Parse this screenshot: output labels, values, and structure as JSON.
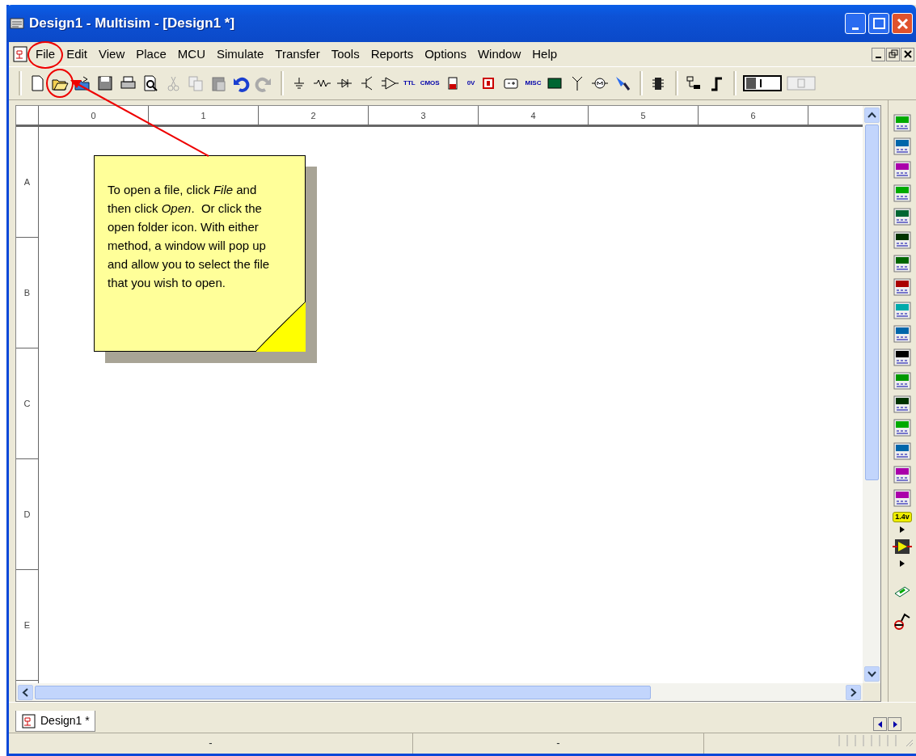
{
  "window": {
    "title": "Design1 - Multisim - [Design1 *]"
  },
  "menu": [
    {
      "label": "File",
      "circled": true
    },
    {
      "label": "Edit",
      "circled": false
    },
    {
      "label": "View",
      "circled": false
    },
    {
      "label": "Place",
      "circled": false
    },
    {
      "label": "MCU",
      "circled": false
    },
    {
      "label": "Simulate",
      "circled": false
    },
    {
      "label": "Transfer",
      "circled": false
    },
    {
      "label": "Tools",
      "circled": false
    },
    {
      "label": "Reports",
      "circled": false
    },
    {
      "label": "Options",
      "circled": false
    },
    {
      "label": "Window",
      "circled": false
    },
    {
      "label": "Help",
      "circled": false
    }
  ],
  "toolbar": {
    "open_circled": true,
    "ttl_label": "TTL",
    "cmos_label": "CMOS",
    "misc_label": "MISC",
    "meter_label": "0V"
  },
  "simulation_switch": {
    "on": false,
    "pause_enabled": false
  },
  "ruler": {
    "columns": [
      "0",
      "1",
      "2",
      "3",
      "4",
      "5",
      "6"
    ],
    "rows": [
      "A",
      "B",
      "C",
      "D",
      "E"
    ]
  },
  "note": {
    "text": "To open a file, click *File* and then click *Open*.  Or click the open folder icon. With either method, a window will pop up and allow you to select the file that you wish to open."
  },
  "instruments": {
    "probe_label": "1.4v"
  },
  "tabs": [
    {
      "label": "Design1 *",
      "selected": true
    }
  ],
  "status_bar": [
    "-",
    "-"
  ]
}
